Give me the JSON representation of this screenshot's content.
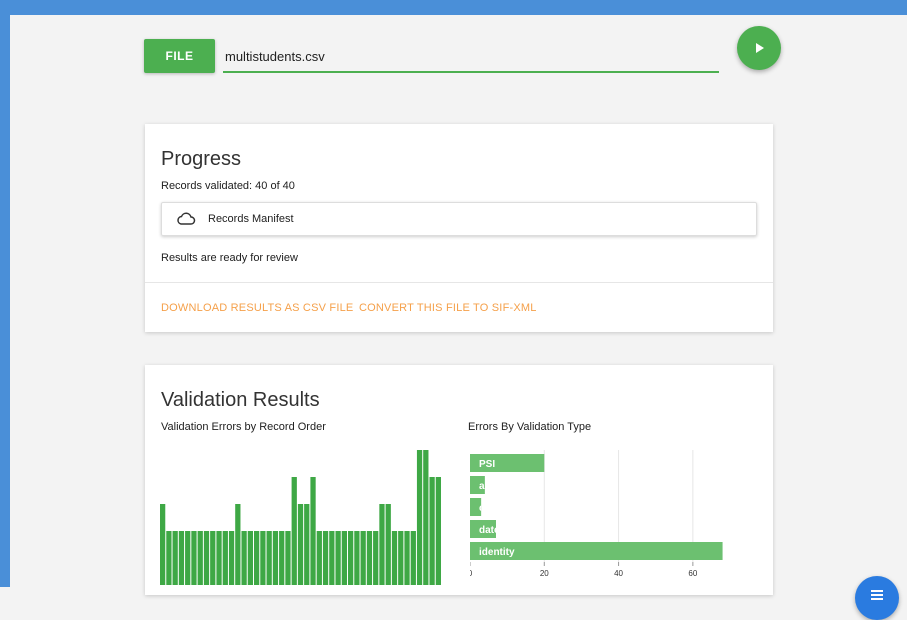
{
  "file_button": {
    "label": "FILE"
  },
  "file_input": {
    "value": "multistudents.csv"
  },
  "progress": {
    "title": "Progress",
    "records_validated": "Records validated: 40 of 40",
    "manifest_label": "Records Manifest",
    "status": "Results are ready for review",
    "actions": [
      "DOWNLOAD RESULTS AS CSV FILE",
      "CONVERT THIS FILE TO SIF-XML"
    ]
  },
  "results": {
    "title": "Validation Results",
    "left_chart_title": "Validation Errors by Record Order",
    "right_chart_title": "Errors By Validation Type"
  },
  "colors": {
    "accent": "#4caf50",
    "action": "#f5a04a",
    "fab": "#2a7be0"
  },
  "chart_data": [
    {
      "type": "bar",
      "title": "Validation Errors by Record Order",
      "values": [
        3,
        2,
        2,
        2,
        2,
        2,
        2,
        2,
        2,
        2,
        2,
        2,
        3,
        2,
        2,
        2,
        2,
        2,
        2,
        2,
        2,
        4,
        3,
        3,
        4,
        2,
        2,
        2,
        2,
        2,
        2,
        2,
        2,
        2,
        2,
        3,
        3,
        2,
        2,
        2,
        2,
        5,
        5,
        4,
        4
      ],
      "ylim": [
        0,
        5
      ]
    },
    {
      "type": "bar",
      "orientation": "horizontal",
      "title": "Errors By Validation Type",
      "categories": [
        "PSI",
        "as",
        "c",
        "date",
        "identity"
      ],
      "values": [
        20,
        4,
        3,
        7,
        68
      ],
      "xticks": [
        0,
        20,
        40,
        60
      ],
      "xlim": [
        0,
        70
      ]
    }
  ]
}
